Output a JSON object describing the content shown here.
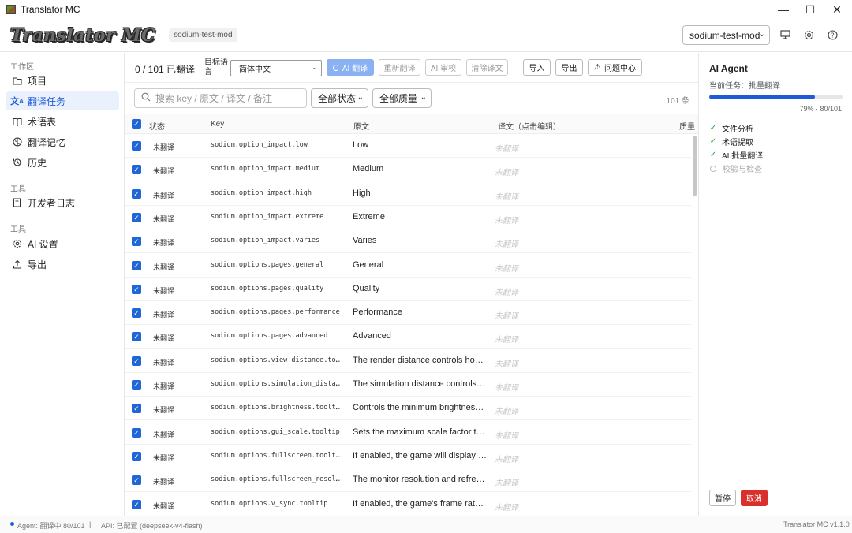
{
  "window": {
    "title": "Translator MC",
    "controls": [
      "—",
      "☐",
      "✕"
    ]
  },
  "header": {
    "logo": "Translator MC",
    "project_chip": "sodium-test-mod",
    "project_select": "sodium-test-mod",
    "icons": [
      "monitor-icon",
      "gear-icon",
      "help-icon"
    ]
  },
  "sidebar": {
    "section_workspace": "工作区",
    "section_tools": "工具",
    "section_tools2": "工具",
    "items": [
      {
        "label": "项目",
        "icon": "folder-icon"
      },
      {
        "label": "翻译任务",
        "icon": "translate-icon",
        "active": true
      },
      {
        "label": "术语表",
        "icon": "book-icon"
      },
      {
        "label": "翻译记忆",
        "icon": "brain-icon"
      },
      {
        "label": "历史",
        "icon": "history-icon"
      },
      {
        "label": "开发者日志",
        "icon": "log-icon"
      },
      {
        "label": "AI 设置",
        "icon": "gear-icon"
      },
      {
        "label": "导出",
        "icon": "upload-icon"
      }
    ]
  },
  "toolbar": {
    "count": "0 / 101 已翻译",
    "target_lang_label": "目标语言",
    "target_lang_value": "简体中文",
    "ai_translate": "AI 翻译",
    "retranslate": "重新翻译",
    "ai_review": "AI 审校",
    "clear": "清除译文",
    "import": "导入",
    "export": "导出",
    "issues": "问题中心"
  },
  "filters": {
    "search_placeholder": "搜索 key / 原文 / 译文 / 备注",
    "status": "全部状态",
    "quality": "全部质量",
    "total": "101 条"
  },
  "table": {
    "headers": {
      "status": "状态",
      "key": "Key",
      "source": "原文",
      "target": "译文（点击编辑）",
      "quality": "质量"
    },
    "rows": [
      {
        "status": "未翻译",
        "key": "sodium.option_impact.low",
        "source": "Low",
        "target": "未翻译"
      },
      {
        "status": "未翻译",
        "key": "sodium.option_impact.medium",
        "source": "Medium",
        "target": "未翻译"
      },
      {
        "status": "未翻译",
        "key": "sodium.option_impact.high",
        "source": "High",
        "target": "未翻译"
      },
      {
        "status": "未翻译",
        "key": "sodium.option_impact.extreme",
        "source": "Extreme",
        "target": "未翻译"
      },
      {
        "status": "未翻译",
        "key": "sodium.option_impact.varies",
        "source": "Varies",
        "target": "未翻译"
      },
      {
        "status": "未翻译",
        "key": "sodium.options.pages.general",
        "source": "General",
        "target": "未翻译"
      },
      {
        "status": "未翻译",
        "key": "sodium.options.pages.quality",
        "source": "Quality",
        "target": "未翻译"
      },
      {
        "status": "未翻译",
        "key": "sodium.options.pages.performance",
        "source": "Performance",
        "target": "未翻译"
      },
      {
        "status": "未翻译",
        "key": "sodium.options.pages.advanced",
        "source": "Advanced",
        "target": "未翻译"
      },
      {
        "status": "未翻译",
        "key": "sodium.options.view_distance.too…",
        "source": "The render distance controls how …",
        "target": "未翻译"
      },
      {
        "status": "未翻译",
        "key": "sodium.options.simulation_distan…",
        "source": "The simulation distance controls h…",
        "target": "未翻译"
      },
      {
        "status": "未翻译",
        "key": "sodium.options.brightness.tooltip",
        "source": "Controls the minimum brightness …",
        "target": "未翻译"
      },
      {
        "status": "未翻译",
        "key": "sodium.options.gui_scale.tooltip",
        "source": "Sets the maximum scale factor to …",
        "target": "未翻译"
      },
      {
        "status": "未翻译",
        "key": "sodium.options.fullscreen.tooltip",
        "source": "If enabled, the game will display i…",
        "target": "未翻译"
      },
      {
        "status": "未翻译",
        "key": "sodium.options.fullscreen_resolu…",
        "source": "The monitor resolution and refres…",
        "target": "未翻译"
      },
      {
        "status": "未翻译",
        "key": "sodium.options.v_sync.tooltip",
        "source": "If enabled, the game's frame rate …",
        "target": "未翻译"
      }
    ]
  },
  "agent": {
    "title": "AI Agent",
    "task": "当前任务：批量翻译",
    "progress_fraction": 0.79,
    "progress_text": "79% · 80/101",
    "steps": [
      {
        "label": "文件分析",
        "done": true
      },
      {
        "label": "术语提取",
        "done": true
      },
      {
        "label": "AI 批量翻译",
        "done": true
      },
      {
        "label": "校验与检查",
        "done": false
      }
    ],
    "pause": "暂停",
    "cancel": "取消"
  },
  "statusbar": {
    "agent": "Agent: 翻译中 80/101",
    "sep": "|",
    "api": "API: 已配置 (deepseek-v4-flash)",
    "version": "Translator MC v1.1.0"
  },
  "colors": {
    "accent": "#1f5bd8",
    "checkbox": "#1f66d6",
    "cancel": "#d9302c",
    "done": "#27a844"
  }
}
